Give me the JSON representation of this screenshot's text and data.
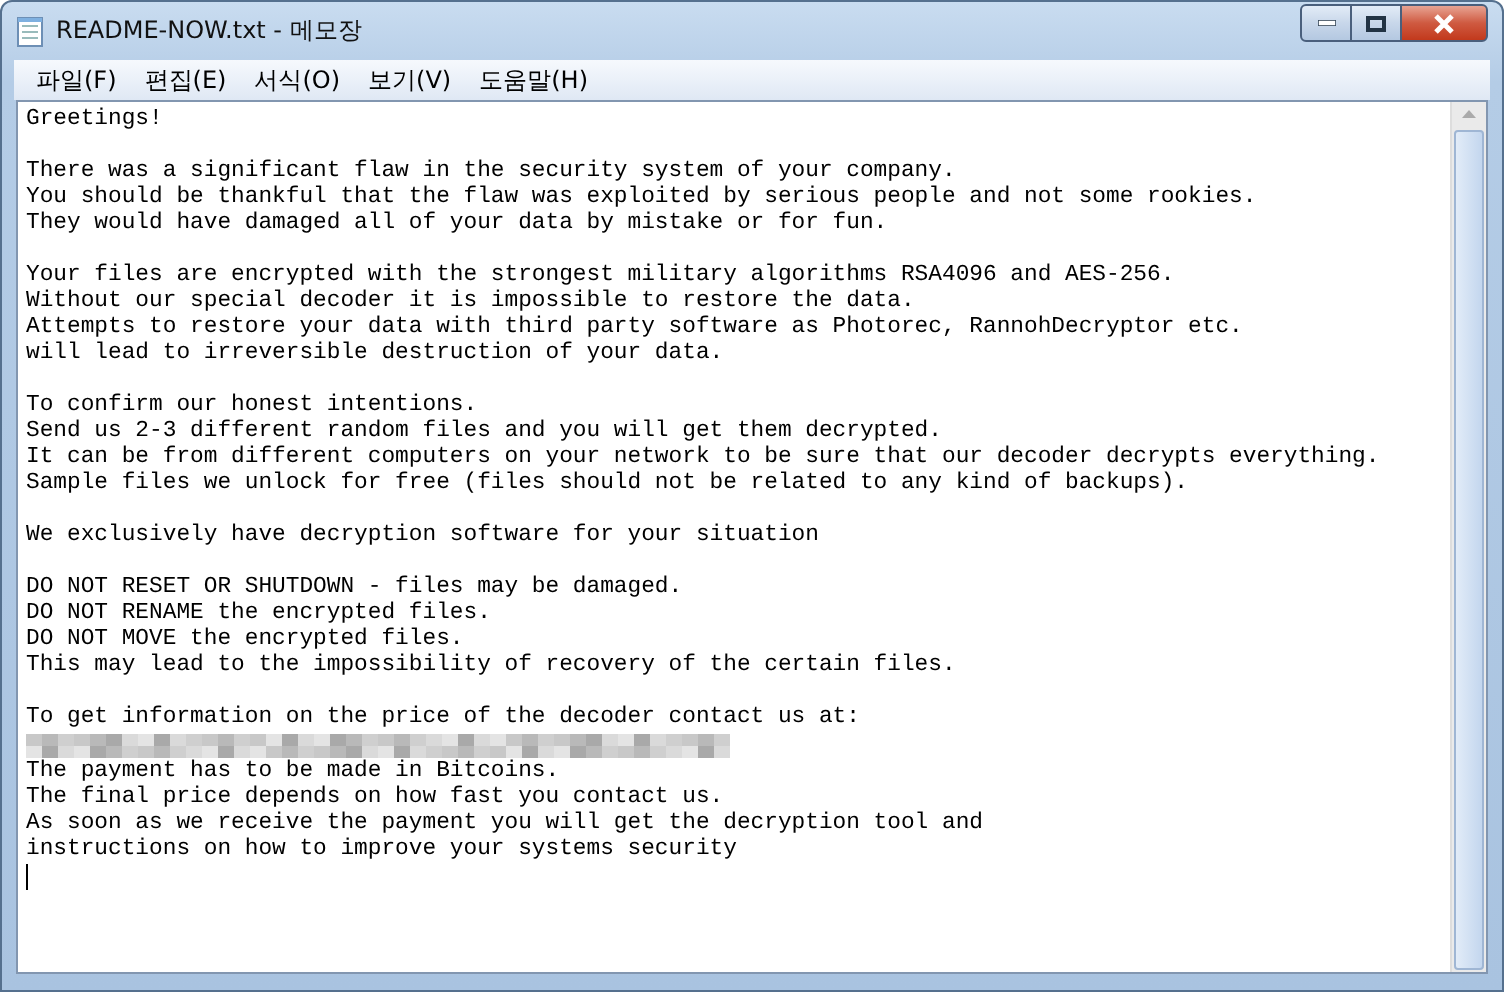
{
  "window": {
    "title": "README-NOW.txt - 메모장"
  },
  "menu": [
    {
      "label": "파일(F)"
    },
    {
      "label": "편집(E)"
    },
    {
      "label": "서식(O)"
    },
    {
      "label": "보기(V)"
    },
    {
      "label": "도움말(H)"
    }
  ],
  "document": {
    "lines": [
      {
        "kind": "text",
        "text": "Greetings!"
      },
      {
        "kind": "blank"
      },
      {
        "kind": "text",
        "text": "There was a significant flaw in the security system of your company."
      },
      {
        "kind": "text",
        "text": "You should be thankful that the flaw was exploited by serious people and not some rookies."
      },
      {
        "kind": "text",
        "text": "They would have damaged all of your data by mistake or for fun."
      },
      {
        "kind": "blank"
      },
      {
        "kind": "text",
        "text": "Your files are encrypted with the strongest military algorithms RSA4096 and AES-256."
      },
      {
        "kind": "text",
        "text": "Without our special decoder it is impossible to restore the data."
      },
      {
        "kind": "text",
        "text": "Attempts to restore your data with third party software as Photorec, RannohDecryptor etc."
      },
      {
        "kind": "text",
        "text": "will lead to irreversible destruction of your data."
      },
      {
        "kind": "blank"
      },
      {
        "kind": "text",
        "text": "To confirm our honest intentions."
      },
      {
        "kind": "text",
        "text": "Send us 2-3 different random files and you will get them decrypted."
      },
      {
        "kind": "text",
        "text": "It can be from different computers on your network to be sure that our decoder decrypts everything."
      },
      {
        "kind": "text",
        "text": "Sample files we unlock for free (files should not be related to any kind of backups)."
      },
      {
        "kind": "blank"
      },
      {
        "kind": "text",
        "text": "We exclusively have decryption software for your situation"
      },
      {
        "kind": "blank"
      },
      {
        "kind": "text",
        "text": "DO NOT RESET OR SHUTDOWN - files may be damaged."
      },
      {
        "kind": "text",
        "text": "DO NOT RENAME the encrypted files."
      },
      {
        "kind": "text",
        "text": "DO NOT MOVE the encrypted files."
      },
      {
        "kind": "text",
        "text": "This may lead to the impossibility of recovery of the certain files."
      },
      {
        "kind": "blank"
      },
      {
        "kind": "text",
        "text": "To get information on the price of the decoder contact us at:"
      },
      {
        "kind": "redacted"
      },
      {
        "kind": "text",
        "text": "The payment has to be made in Bitcoins."
      },
      {
        "kind": "text",
        "text": "The final price depends on how fast you contact us."
      },
      {
        "kind": "text",
        "text": "As soon as we receive the payment you will get the decryption tool and"
      },
      {
        "kind": "text",
        "text": "instructions on how to improve your systems security"
      },
      {
        "kind": "cursor"
      }
    ]
  }
}
